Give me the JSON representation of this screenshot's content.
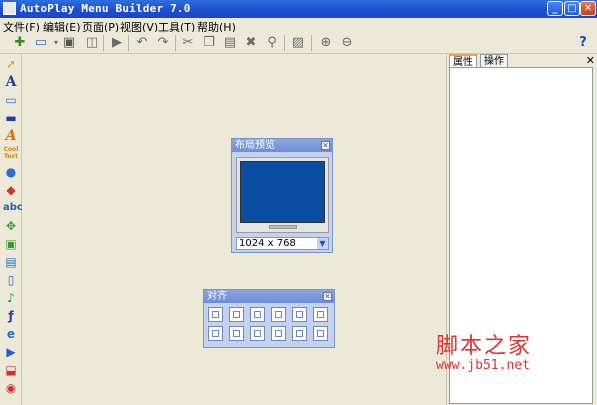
{
  "window": {
    "title": "AutoPlay Menu Builder 7.0",
    "minimize": "_",
    "maximize": "□",
    "close": "✕"
  },
  "menu": [
    "文件(F)",
    "编辑(E)",
    "页面(P)",
    "视图(V)",
    "工具(T)",
    "帮助(H)"
  ],
  "toolbar": [
    "new-icon",
    "open-icon",
    "save-icon",
    "preview-icon",
    "play-icon",
    "undo-icon",
    "redo-icon",
    "cut-icon",
    "copy-icon",
    "paste-icon",
    "delete-icon",
    "find-icon",
    "image-icon",
    "add-page-icon",
    "remove-page-icon",
    "help-icon"
  ],
  "left_tools": [
    "pointer-icon",
    "text-icon",
    "button-icon",
    "bar-icon",
    "label-icon",
    "cool-text-icon",
    "globe-icon",
    "shape-icon",
    "abc-icon",
    "move-icon",
    "image-tool-icon",
    "doc-icon",
    "page-icon",
    "music-icon",
    "flash-icon",
    "ie-icon",
    "video-icon",
    "pdf-icon",
    "chat-icon"
  ],
  "cool_text_label": "Cool Text",
  "layout_preview": {
    "title": "布局预览",
    "resolution": "1024 x 768"
  },
  "align_panel": {
    "title": "对齐"
  },
  "properties": {
    "tabs": [
      "属性",
      "操作"
    ],
    "close": "✕"
  },
  "watermark": {
    "text": "脚本之家",
    "url": "www.jb51.net"
  }
}
